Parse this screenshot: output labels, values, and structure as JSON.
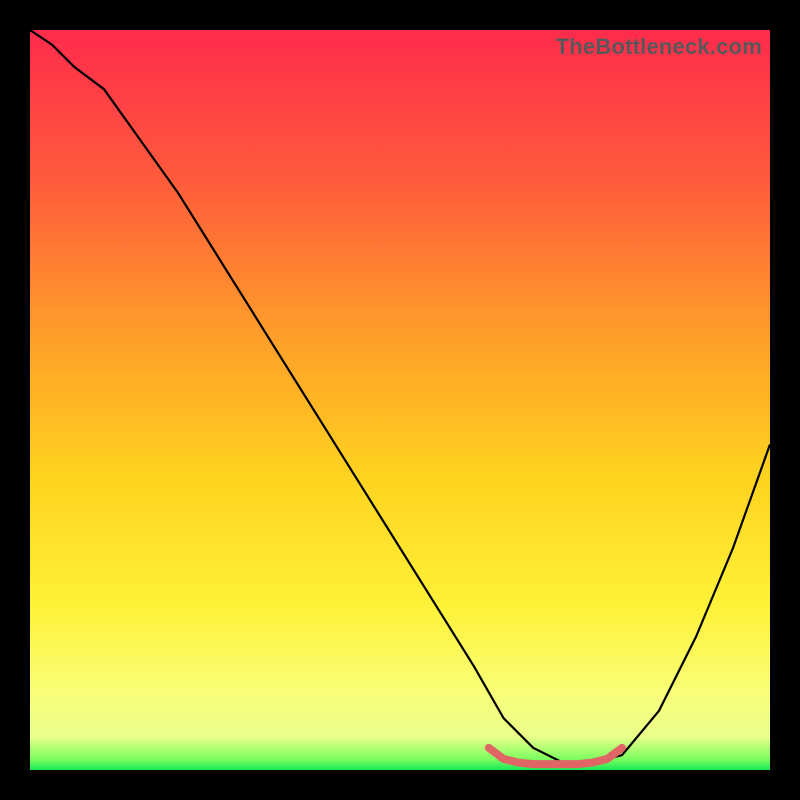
{
  "watermark": "TheBottleneck.com",
  "chart_data": {
    "type": "line",
    "title": "",
    "xlabel": "",
    "ylabel": "",
    "xlim": [
      0,
      100
    ],
    "ylim": [
      0,
      100
    ],
    "grid": false,
    "legend": false,
    "gradient_stops": [
      {
        "offset": 0.0,
        "color": "#ff2b4c"
      },
      {
        "offset": 0.2,
        "color": "#ff5a3c"
      },
      {
        "offset": 0.4,
        "color": "#ff9a2a"
      },
      {
        "offset": 0.6,
        "color": "#ffd21f"
      },
      {
        "offset": 0.78,
        "color": "#fff238"
      },
      {
        "offset": 0.9,
        "color": "#f8ff7a"
      },
      {
        "offset": 0.955,
        "color": "#eaff8a"
      },
      {
        "offset": 0.985,
        "color": "#7dff5e"
      },
      {
        "offset": 1.0,
        "color": "#17e856"
      }
    ],
    "series": [
      {
        "name": "bottleneck-curve",
        "color": "#000000",
        "x": [
          0,
          3,
          6,
          10,
          15,
          20,
          25,
          30,
          35,
          40,
          45,
          50,
          55,
          60,
          64,
          68,
          72,
          76,
          80,
          85,
          90,
          95,
          100
        ],
        "y": [
          100,
          98,
          95,
          92,
          85,
          78,
          70,
          62,
          54,
          46,
          38,
          30,
          22,
          14,
          7,
          3,
          1,
          1,
          2,
          8,
          18,
          30,
          44
        ]
      },
      {
        "name": "optimal-range-marker",
        "color": "#e06666",
        "x": [
          62,
          64,
          66,
          68,
          70,
          72,
          74,
          76,
          78,
          80
        ],
        "y": [
          3,
          1.5,
          1,
          0.8,
          0.8,
          0.8,
          0.8,
          1,
          1.5,
          3
        ]
      }
    ]
  }
}
